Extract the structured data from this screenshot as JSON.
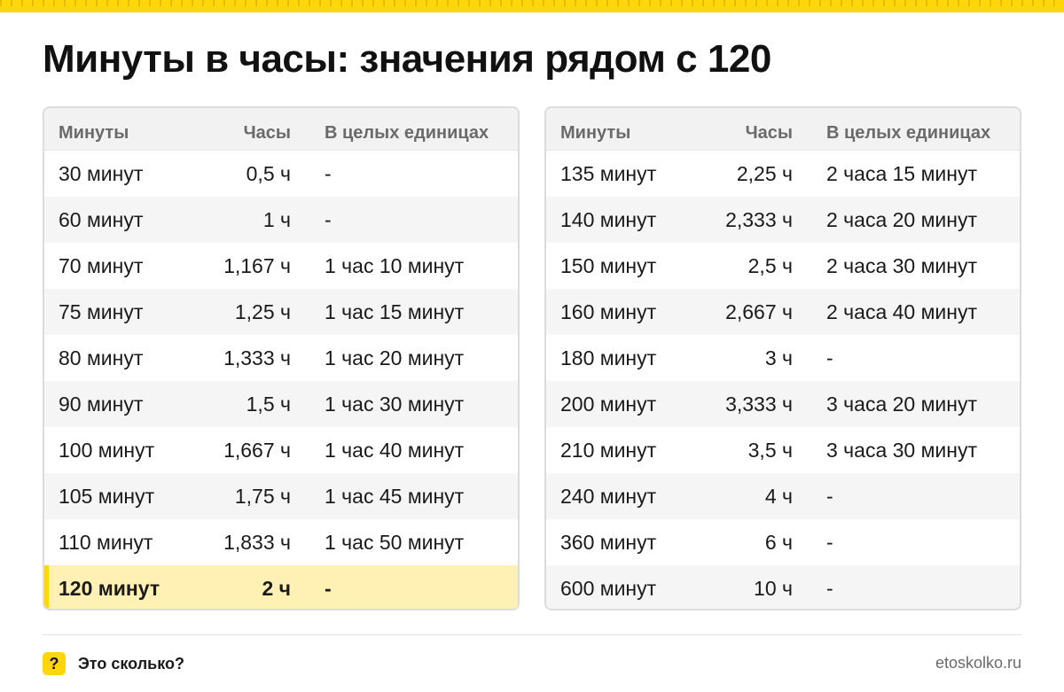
{
  "title": "Минуты в часы: значения рядом с 120",
  "colors": {
    "accent": "#ffd60a",
    "highlight_row": "#fff1b3",
    "header_bg": "#f2f2f2"
  },
  "tables": [
    {
      "headers": [
        "Минуты",
        "Часы",
        "В целых единицах"
      ],
      "rows": [
        {
          "minutes": "30 минут",
          "hours": "0,5 ч",
          "whole": "-"
        },
        {
          "minutes": "60 минут",
          "hours": "1 ч",
          "whole": "-"
        },
        {
          "minutes": "70 минут",
          "hours": "1,167 ч",
          "whole": "1 час 10 минут"
        },
        {
          "minutes": "75 минут",
          "hours": "1,25 ч",
          "whole": "1 час 15 минут"
        },
        {
          "minutes": "80 минут",
          "hours": "1,333 ч",
          "whole": "1 час 20 минут"
        },
        {
          "minutes": "90 минут",
          "hours": "1,5 ч",
          "whole": "1 час 30 минут"
        },
        {
          "minutes": "100 минут",
          "hours": "1,667 ч",
          "whole": "1 час 40 минут"
        },
        {
          "minutes": "105 минут",
          "hours": "1,75 ч",
          "whole": "1 час 45 минут"
        },
        {
          "minutes": "110 минут",
          "hours": "1,833 ч",
          "whole": "1 час 50 минут"
        },
        {
          "minutes": "120 минут",
          "hours": "2 ч",
          "whole": "-",
          "highlighted": true
        }
      ]
    },
    {
      "headers": [
        "Минуты",
        "Часы",
        "В целых единицах"
      ],
      "rows": [
        {
          "minutes": "135 минут",
          "hours": "2,25 ч",
          "whole": "2 часа 15 минут"
        },
        {
          "minutes": "140 минут",
          "hours": "2,333 ч",
          "whole": "2 часа 20 минут"
        },
        {
          "minutes": "150 минут",
          "hours": "2,5 ч",
          "whole": "2 часа 30 минут"
        },
        {
          "minutes": "160 минут",
          "hours": "2,667 ч",
          "whole": "2 часа 40 минут"
        },
        {
          "minutes": "180 минут",
          "hours": "3 ч",
          "whole": "-"
        },
        {
          "minutes": "200 минут",
          "hours": "3,333 ч",
          "whole": "3 часа 20 минут"
        },
        {
          "minutes": "210 минут",
          "hours": "3,5 ч",
          "whole": "3 часа 30 минут"
        },
        {
          "minutes": "240 минут",
          "hours": "4 ч",
          "whole": "-"
        },
        {
          "minutes": "360 минут",
          "hours": "6 ч",
          "whole": "-"
        },
        {
          "minutes": "600 минут",
          "hours": "10 ч",
          "whole": "-"
        }
      ]
    }
  ],
  "footer": {
    "icon": "question-icon",
    "icon_glyph": "?",
    "brand": "Это сколько?",
    "site": "etoskolko.ru"
  }
}
